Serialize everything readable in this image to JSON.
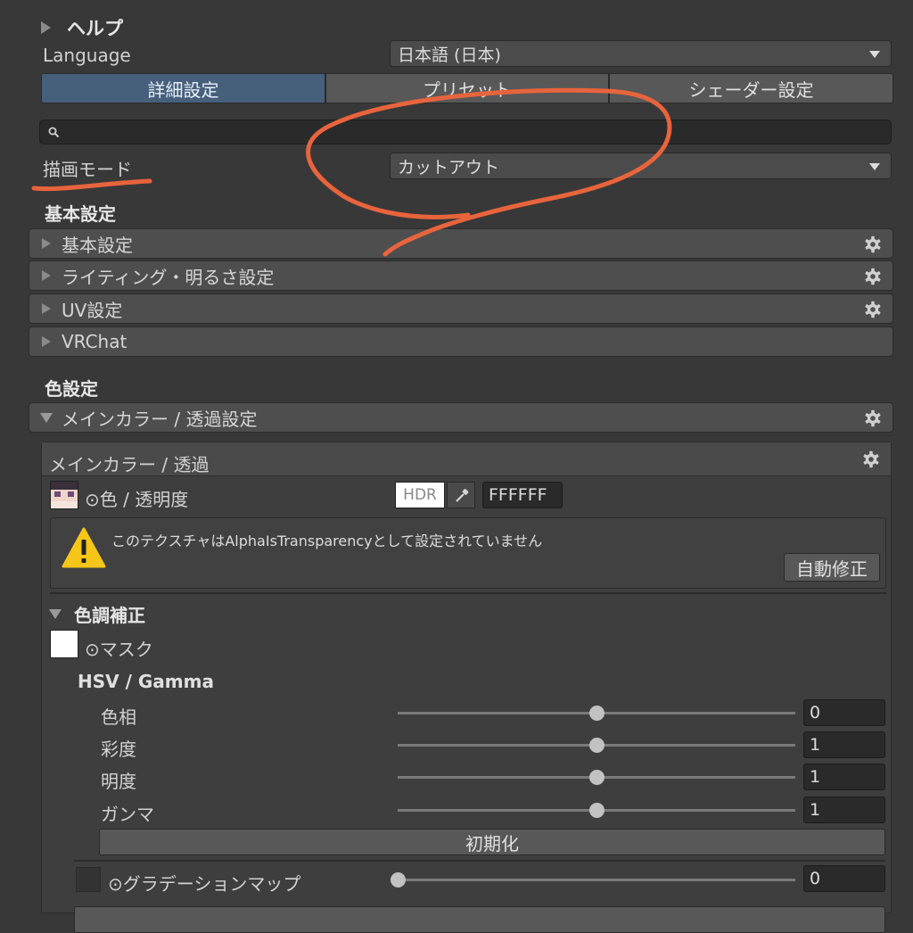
{
  "help": {
    "label": "ヘルプ"
  },
  "language": {
    "label": "Language",
    "value": "日本語 (日本)"
  },
  "tabs": [
    {
      "label": "詳細設定",
      "active": true
    },
    {
      "label": "プリセット",
      "active": false
    },
    {
      "label": "シェーダー設定",
      "active": false
    }
  ],
  "search": {
    "placeholder": ""
  },
  "render_mode": {
    "label": "描画モード",
    "value": "カットアウト"
  },
  "section_basic": {
    "title": "基本設定"
  },
  "basic_foldouts": [
    {
      "label": "基本設定"
    },
    {
      "label": "ライティング・明るさ設定"
    },
    {
      "label": "UV設定"
    },
    {
      "label": "VRChat"
    }
  ],
  "section_color": {
    "title": "色設定"
  },
  "main_color_foldout": {
    "label": "メインカラー / 透過設定"
  },
  "main_color_panel": {
    "title": "メインカラー / 透過",
    "color_label": "⊙色 / 透明度",
    "hdr_label": "HDR",
    "hex_value": "FFFFFF",
    "warning_text": "このテクスチャはAlphaIsTransparencyとして設定されていません",
    "autofix_label": "自動修正"
  },
  "color_adjust": {
    "title": "色調補正",
    "mask_label": "⊙マスク",
    "hsv_title": "HSV / Gamma",
    "sliders": [
      {
        "label": "色相",
        "value": "0",
        "fraction": 0.5
      },
      {
        "label": "彩度",
        "value": "1",
        "fraction": 0.5
      },
      {
        "label": "明度",
        "value": "1",
        "fraction": 0.5
      },
      {
        "label": "ガンマ",
        "value": "1",
        "fraction": 0.5
      }
    ],
    "reset_label": "初期化",
    "gradient": {
      "label": "⊙グラデーションマップ",
      "value": "0",
      "fraction": 0.0
    }
  },
  "colors": {
    "background": "#383838",
    "tab_active": "#46607c",
    "warning": "#f5c518",
    "annotation": "#e8643c"
  }
}
